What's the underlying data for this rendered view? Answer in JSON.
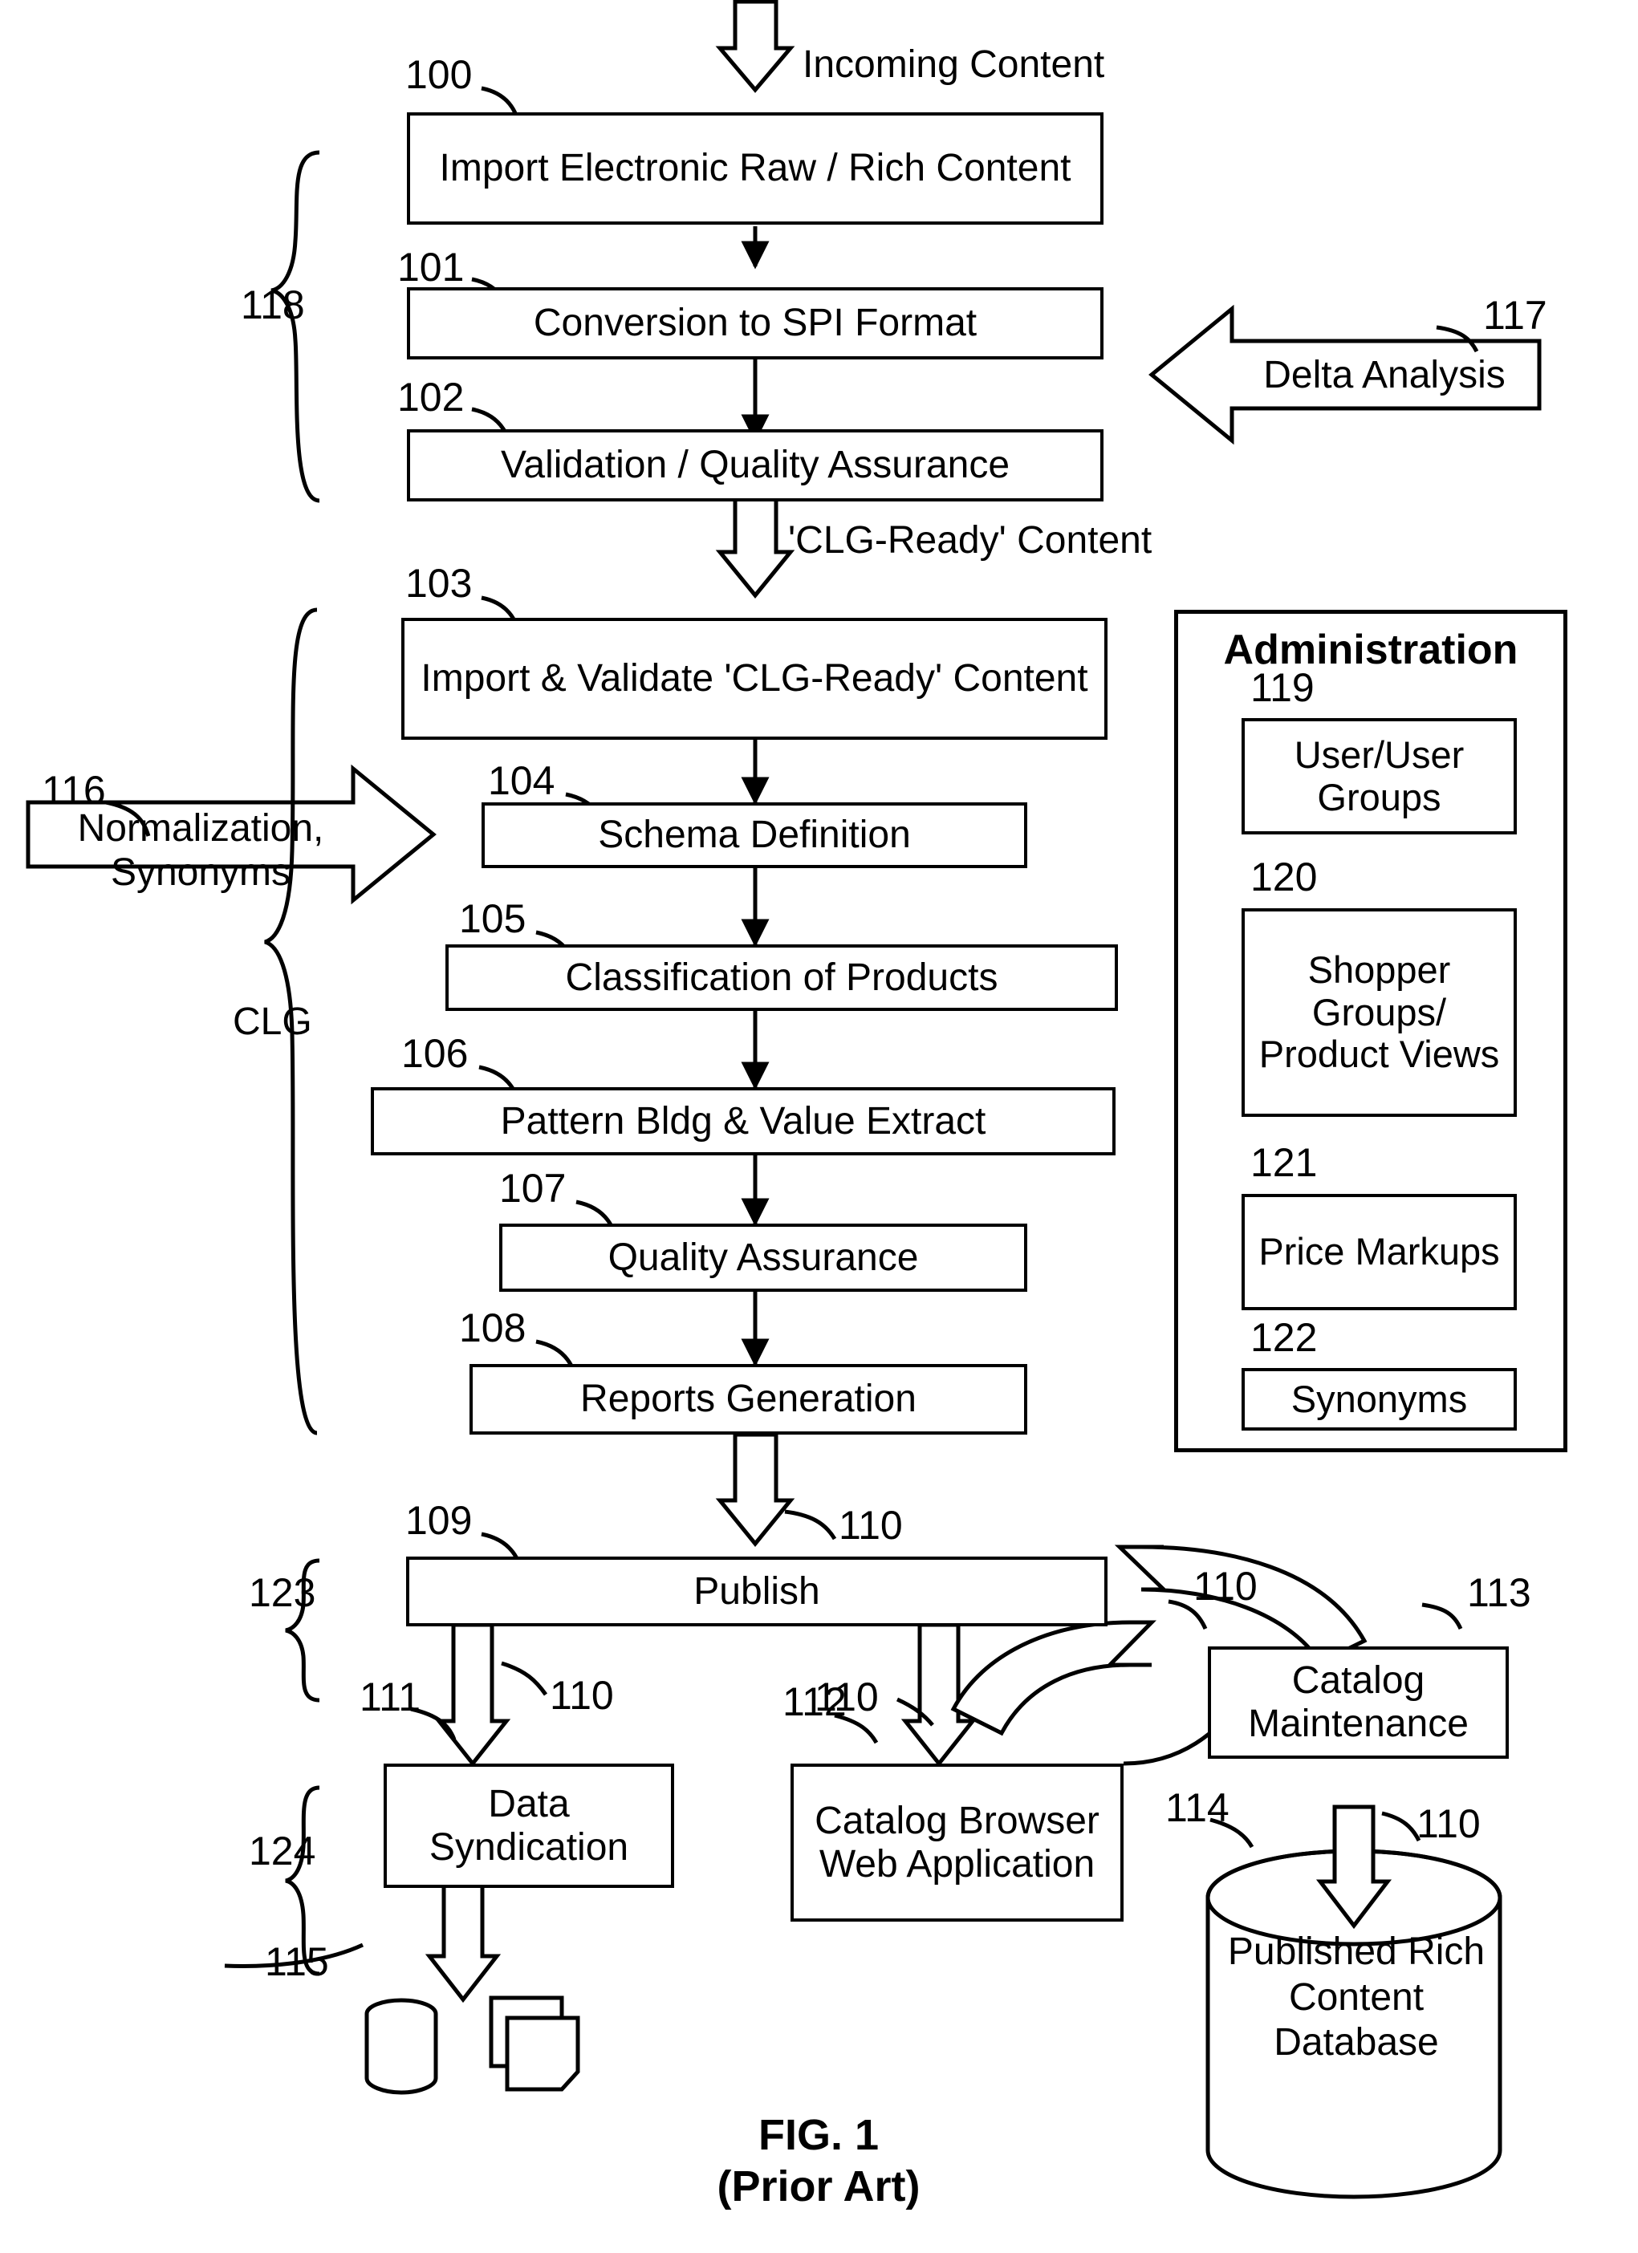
{
  "figure": {
    "caption_line1": "FIG. 1",
    "caption_line2": "(Prior Art)"
  },
  "labels": {
    "incoming_content": "Incoming Content",
    "clg_ready_content": "'CLG-Ready' Content",
    "clg_bracket": "CLG",
    "administration": "Administration"
  },
  "boxes": {
    "b100": "Import Electronic Raw / Rich Content",
    "b101": "Conversion to SPI Format",
    "b102": "Validation / Quality Assurance",
    "b103": "Import & Validate 'CLG-Ready' Content",
    "b104": "Schema Definition",
    "b105": "Classification of Products",
    "b106": "Pattern Bldg & Value Extract",
    "b107": "Quality Assurance",
    "b108": "Reports Generation",
    "b109": "Publish",
    "b111": "Data Syndication",
    "b112": "Catalog Browser Web Application",
    "b113": "Catalog Maintenance",
    "b114": "Published Rich Content Database",
    "b116": "Normalization, Synonyms",
    "b117": "Delta Analysis",
    "b119": "User/User Groups",
    "b120": "Shopper Groups/ Product Views",
    "b121": "Price Markups",
    "b122": "Synonyms"
  },
  "refs": {
    "r100": "100",
    "r101": "101",
    "r102": "102",
    "r103": "103",
    "r104": "104",
    "r105": "105",
    "r106": "106",
    "r107": "107",
    "r108": "108",
    "r109": "109",
    "r110a": "110",
    "r110b": "110",
    "r110c": "110",
    "r110d": "110",
    "r110e": "110",
    "r111": "111",
    "r112": "112",
    "r113": "113",
    "r114": "114",
    "r115": "115",
    "r116": "116",
    "r117": "117",
    "r118": "118",
    "r119": "119",
    "r120": "120",
    "r121": "121",
    "r122": "122",
    "r123": "123",
    "r124": "124"
  },
  "colors": {
    "stroke": "#000000",
    "fill": "#ffffff"
  }
}
